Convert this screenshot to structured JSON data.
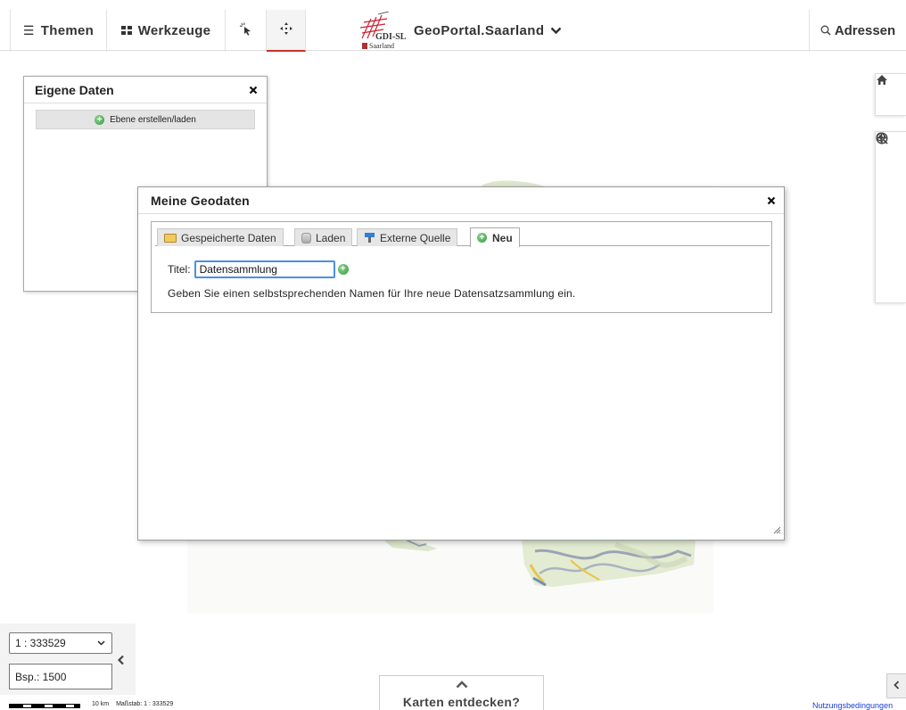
{
  "topbar": {
    "themen_label": "Themen",
    "werkzeuge_label": "Werkzeuge",
    "brand_logo_text": "GDI-SL",
    "brand_logo_sub": "Saarland",
    "brand_title": "GeoPortal.Saarland",
    "adressen_label": "Adressen"
  },
  "icons": {
    "menu": "hamburger-icon",
    "grid": "grid-icon",
    "select": "pointer-click-icon",
    "pan": "move-arrows-icon",
    "chevron": "chevron-down-icon",
    "search": "search-icon",
    "home": "home-icon",
    "zoom_in": "plus-icon",
    "globe": "globe-icon",
    "zoom_out": "minus-icon",
    "zoom_extent": "zoom-magnifier-icon"
  },
  "eigene_daten": {
    "title": "Eigene Daten",
    "ebene_button": "Ebene erstellen/laden"
  },
  "dialog": {
    "title": "Meine Geodaten",
    "tabs": [
      {
        "label": "Gespeicherte Daten",
        "active": false
      },
      {
        "label": "Laden",
        "active": false
      },
      {
        "label": "Externe Quelle",
        "active": false
      },
      {
        "label": "Neu",
        "active": true
      }
    ],
    "titel_label": "Titel:",
    "titel_value": "Datensammlung",
    "hint": "Geben Sie einen selbstsprechenden Namen für Ihre neue Datensatzsammlung ein."
  },
  "bottom": {
    "scale_selected": "1 : 333529",
    "beispiel_value": "Bsp.: 1500",
    "scale_km": "10 km",
    "scale_label": "Maßstab: 1 : 333529",
    "karten_label": "Karten entdecken?",
    "nutzung_label": "Nutzungsbedingungen"
  },
  "colors": {
    "accent_active": "#c9302c",
    "input_focus": "#4a90e2",
    "link": "#1a3fd6",
    "add_green": "#2f9a3a"
  }
}
